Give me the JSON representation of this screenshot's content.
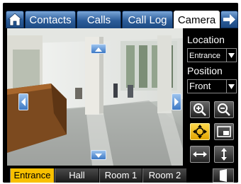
{
  "top_tabs": {
    "home_icon": "home-icon",
    "items": [
      {
        "label": "Contacts"
      },
      {
        "label": "Calls"
      },
      {
        "label": "Call Log"
      },
      {
        "label": "Camera"
      }
    ],
    "active": "Camera",
    "next_icon": "arrow-right-icon"
  },
  "camera": {
    "pan_controls": [
      "arrow-up-icon",
      "arrow-down-icon",
      "arrow-left-icon",
      "arrow-right-icon"
    ]
  },
  "panel": {
    "location_label": "Location",
    "location_value": "Entrance",
    "position_label": "Position",
    "position_value": "Front",
    "buttons": [
      "zoom-in-icon",
      "zoom-out-icon",
      "pan-mode-icon",
      "fullscreen-icon",
      "horizontal-icon",
      "vertical-icon"
    ]
  },
  "bottom_tabs": {
    "items": [
      {
        "label": "Entrance"
      },
      {
        "label": "Hall"
      },
      {
        "label": "Room 1"
      },
      {
        "label": "Room 2"
      }
    ],
    "active": "Entrance",
    "door_icon": "door-icon"
  },
  "colors": {
    "tab_blue": "#2c5d9a",
    "active_yellow": "#f8c000",
    "nav_blue": "#3c78c4"
  }
}
